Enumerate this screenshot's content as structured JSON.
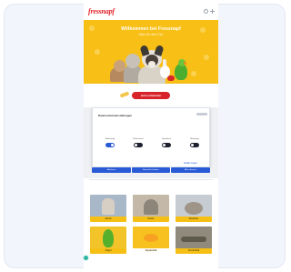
{
  "header": {
    "logo_text": "fressnapf"
  },
  "hero": {
    "title": "Willkommen bei Fressnapf",
    "subtitle": "Alles für dein Tier"
  },
  "banner": {
    "cta_label": "Jetzt entdecken"
  },
  "consent": {
    "title": "Datenschutzeinstellungen",
    "text": "",
    "categories": [
      {
        "label": "Notwendig",
        "enabled": true
      },
      {
        "label": "Präferenzen",
        "enabled": false
      },
      {
        "label": "Statistiken",
        "enabled": false
      },
      {
        "label": "Marketing",
        "enabled": false
      }
    ],
    "details_link": "Details zeigen",
    "buttons": {
      "deny": "Ablehnen",
      "allow_selection": "Auswahl erlauben",
      "allow_all": "Alle zulassen"
    }
  },
  "categories_section": {
    "title": "",
    "tiles": [
      {
        "label": "Hund",
        "photo_color": "#a9b8c9"
      },
      {
        "label": "Katze",
        "photo_color": "#c4b9a9"
      },
      {
        "label": "Kleintier",
        "photo_color": "#c7ccd2"
      },
      {
        "label": "Vogel",
        "photo_color": "#f3c42a"
      },
      {
        "label": "Aquaristik",
        "photo_color": "#f7c21f"
      },
      {
        "label": "Terraristik",
        "photo_color": "#8f8a7c"
      }
    ]
  },
  "colors": {
    "brand_red": "#d8232a",
    "hero_yellow": "#f8bf17",
    "consent_blue": "#2a5bd7"
  }
}
